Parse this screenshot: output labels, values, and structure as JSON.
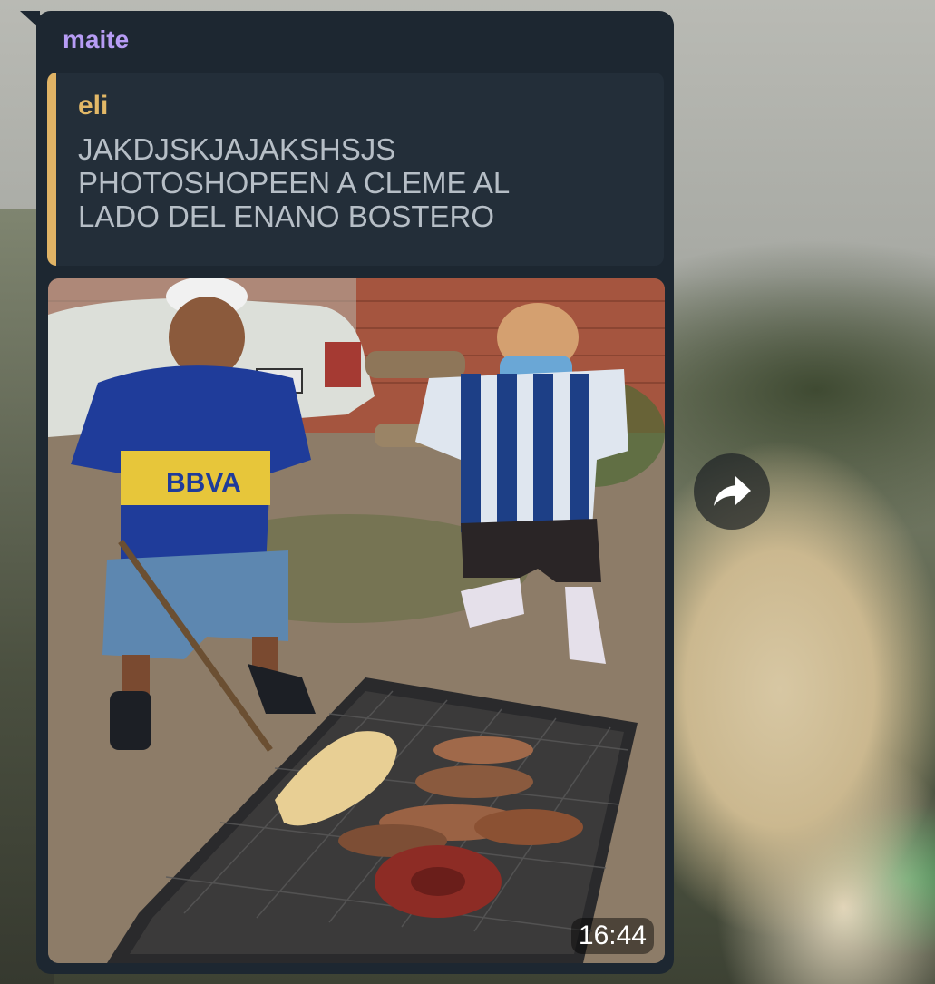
{
  "message": {
    "sender": "maite",
    "reply": {
      "author": "eli",
      "text": "JAKDJSKJAJAKSHSJS\nPHOTOSHOPEEN A CLEME AL\nLADO DEL ENANO BOSTERO"
    },
    "time": "16:44",
    "photo": {
      "jersey_text": "BBVA"
    }
  },
  "icons": {
    "share": "share-arrow-icon"
  },
  "colors": {
    "bubble_bg": "#1d2731",
    "sender_name": "#b79cf5",
    "reply_accent": "#e0b365",
    "reply_text": "#b6bec6"
  }
}
